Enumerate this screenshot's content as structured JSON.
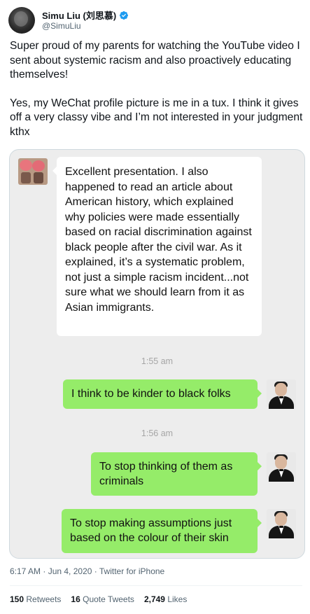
{
  "author": {
    "display_name": "Simu Liu (刘思慕)",
    "handle": "@SimuLiu",
    "verified_color": "#1d9bf0"
  },
  "tweet": {
    "paragraph1": "Super proud of my parents for watching the YouTube video I sent about systemic racism and also proactively educating themselves!",
    "paragraph2": "Yes, my WeChat profile picture is me in a tux. I think it gives off a very classy vibe and I’m not interested in your judgment kthx"
  },
  "chat": {
    "incoming_message": "Excellent presentation. I also happened to read an article about American history, which explained why policies were made essentially based on racial discrimination against black people after the civil war. As it explained, it’s a systematic problem, not just a simple racism incident...not sure what we should learn from it as Asian immigrants.",
    "time1": "1:55 am",
    "reply1": "I think to be kinder to black folks",
    "time2": "1:56 am",
    "reply2": "To stop thinking of them as criminals",
    "reply3": "To stop making assumptions just based on the colour of their skin",
    "bubble_color": "#95ec69",
    "background_color": "#ededed"
  },
  "meta": {
    "timestamp": "6:17 AM · Jun 4, 2020 · Twitter for iPhone"
  },
  "stats": {
    "retweets_count": "150",
    "retweets_label": "Retweets",
    "quotes_count": "16",
    "quotes_label": "Quote Tweets",
    "likes_count": "2,749",
    "likes_label": "Likes"
  }
}
